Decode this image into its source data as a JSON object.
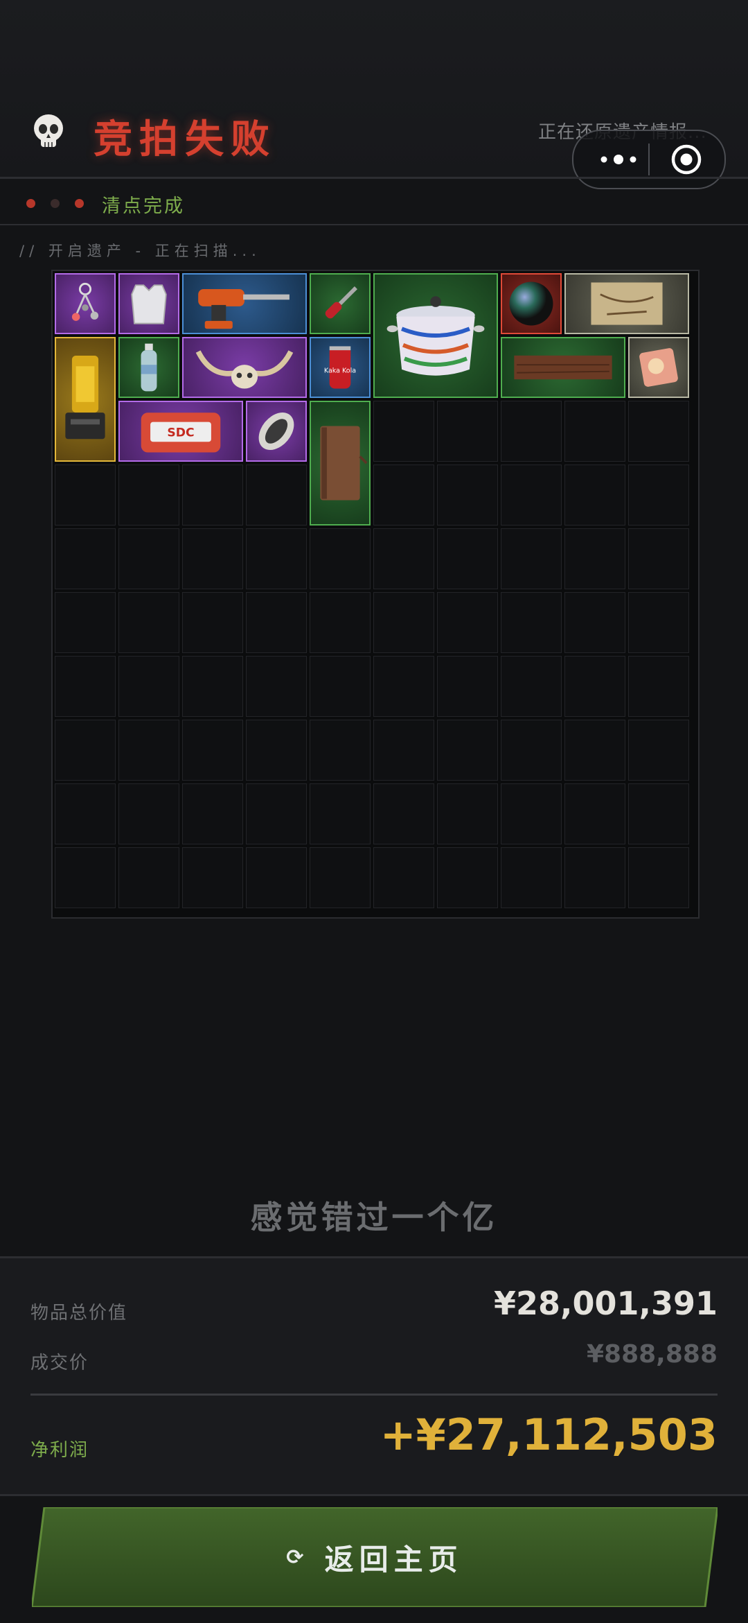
{
  "header": {
    "title": "竞拍失败",
    "restoring_text": "正在还原遗产情报...",
    "skull_icon": "skull-icon"
  },
  "capsule": {
    "more_icon": "more-dots-icon",
    "close_icon": "target-close-icon"
  },
  "status": {
    "text": "清点完成",
    "led_colors": [
      "#c0392b",
      "#3a2a2a",
      "#c0392b"
    ]
  },
  "scan": {
    "text": "// 开启遗产 - 正在扫描..."
  },
  "inventory": {
    "columns": 10,
    "rows": 10,
    "items": [
      {
        "name": "keychain",
        "rarity": "purple",
        "col": 0,
        "row": 0,
        "w": 1,
        "h": 1
      },
      {
        "name": "body-armor",
        "rarity": "purple",
        "col": 1,
        "row": 0,
        "w": 1,
        "h": 1
      },
      {
        "name": "power-drill",
        "rarity": "blue",
        "col": 2,
        "row": 0,
        "w": 2,
        "h": 1
      },
      {
        "name": "screwdriver",
        "rarity": "green",
        "col": 4,
        "row": 0,
        "w": 1,
        "h": 1
      },
      {
        "name": "ceramic-pot",
        "rarity": "green",
        "col": 5,
        "row": 0,
        "w": 2,
        "h": 2
      },
      {
        "name": "glass-orb",
        "rarity": "red",
        "col": 7,
        "row": 0,
        "w": 1,
        "h": 1
      },
      {
        "name": "old-map",
        "rarity": "white",
        "col": 8,
        "row": 0,
        "w": 2,
        "h": 1
      },
      {
        "name": "gold-machine",
        "rarity": "gold",
        "col": 0,
        "row": 1,
        "w": 1,
        "h": 2
      },
      {
        "name": "water-bottle",
        "rarity": "green",
        "col": 1,
        "row": 1,
        "w": 1,
        "h": 1
      },
      {
        "name": "horned-skull",
        "rarity": "purple",
        "col": 2,
        "row": 1,
        "w": 2,
        "h": 1
      },
      {
        "name": "cola-can",
        "rarity": "blue",
        "col": 4,
        "row": 1,
        "w": 1,
        "h": 1
      },
      {
        "name": "wooden-plank",
        "rarity": "green",
        "col": 7,
        "row": 1,
        "w": 2,
        "h": 1
      },
      {
        "name": "food-pack",
        "rarity": "white",
        "col": 9,
        "row": 1,
        "w": 1,
        "h": 1
      },
      {
        "name": "sdc-device",
        "rarity": "purple",
        "col": 1,
        "row": 2,
        "w": 2,
        "h": 1
      },
      {
        "name": "ornate-egg",
        "rarity": "purple",
        "col": 3,
        "row": 2,
        "w": 1,
        "h": 1
      },
      {
        "name": "leather-journal",
        "rarity": "green",
        "col": 4,
        "row": 2,
        "w": 1,
        "h": 2
      }
    ],
    "labels": {
      "cola_text": "Kaka Kola",
      "sdc_text": "SDC"
    }
  },
  "quip": "感觉错过一个亿",
  "summary": {
    "total_label": "物品总价值",
    "total_value": "¥28,001,391",
    "price_label": "成交价",
    "price_value": "¥888,888",
    "profit_label": "净利润",
    "profit_value": "+¥27,112,503"
  },
  "button": {
    "label": "返回主页",
    "icon": "refresh-icon"
  },
  "colors": {
    "title_red": "#d5402f",
    "status_green": "#7ead4c",
    "profit_gold": "#e0b13a",
    "button_green": "#3a5a22"
  }
}
